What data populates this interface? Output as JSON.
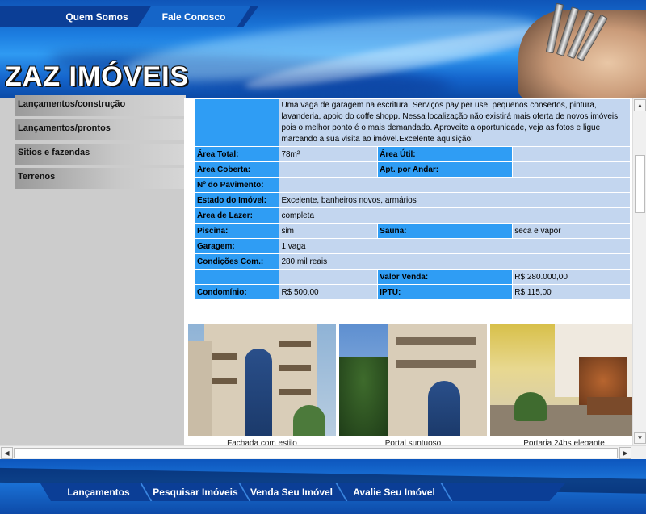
{
  "top_nav": [
    "Quem Somos",
    "Fale Conosco"
  ],
  "brand": "ZAZ IMÓVEIS",
  "sidebar": {
    "items": [
      "Lançamentos/construção",
      "Lançamentos/prontos",
      "Sitios e fazendas",
      "Terrenos"
    ]
  },
  "listing": {
    "description": "Uma vaga de garagem na escritura. Serviços pay per use: pequenos consertos, pintura, lavanderia, apoio do coffe shopp. Nessa localização não existirá mais oferta de novos imóveis, pois o melhor ponto é o mais demandado. Aproveite a oportunidade, veja as fotos e ligue marcando a sua visita ao imóvel.Excelente aquisição!",
    "rows": [
      {
        "l1": "Área Total:",
        "v1": "78m²",
        "l2": "Área Útil:",
        "v2": ""
      },
      {
        "l1": "Área Coberta:",
        "v1": "",
        "l2": "Apt. por Andar:",
        "v2": ""
      },
      {
        "l1": "Nº do Pavimento:",
        "v1": ""
      },
      {
        "l1": "Estado do Imóvel:",
        "v1": "Excelente, banheiros novos, armários"
      },
      {
        "l1": "Área de Lazer:",
        "v1": "completa"
      },
      {
        "l1": "Piscina:",
        "v1": "sim",
        "l2": "Sauna:",
        "v2": "seca e vapor"
      },
      {
        "l1": "Garagem:",
        "v1": "1 vaga"
      },
      {
        "l1": "Condições Com.:",
        "v1": "280 mil reais"
      },
      {
        "l1": "",
        "v1": "",
        "l2": "Valor Venda:",
        "v2": "R$ 280.000,00"
      },
      {
        "l1": "Condomínio:",
        "v1": "R$ 500,00",
        "l2": "IPTU:",
        "v2": "R$ 115,00"
      }
    ]
  },
  "photos": [
    {
      "caption": "Fachada com estilo"
    },
    {
      "caption": "Portal suntuoso"
    },
    {
      "caption": "Portaria 24hs elegante"
    }
  ],
  "bottom_nav": [
    "Lançamentos",
    "Pesquisar Imóveis",
    "Venda Seu Imóvel",
    "Avalie Seu Imóvel"
  ],
  "colors": {
    "label_bg": "#2f9df4",
    "value_bg": "#c3d6ef",
    "header_blue": "#1c7de0",
    "nav_dark": "#0b3e96"
  }
}
